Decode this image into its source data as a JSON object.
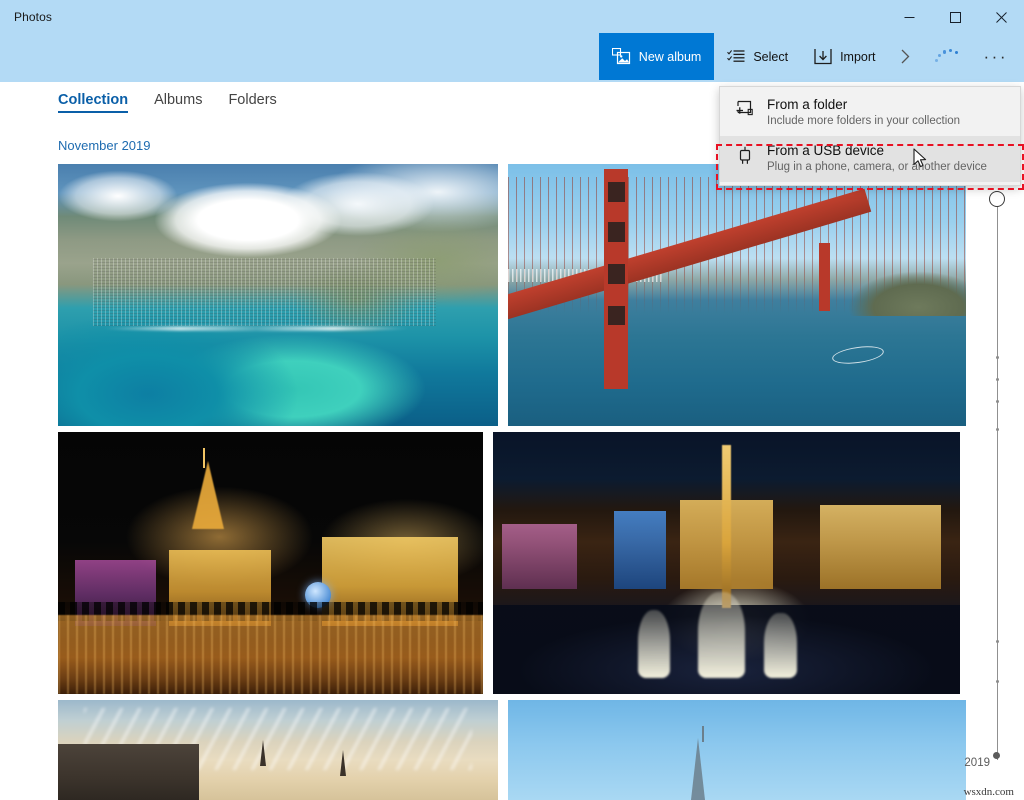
{
  "window": {
    "app_title": "Photos",
    "controls": {
      "minimize": "minimize-button",
      "maximize": "maximize-button",
      "close": "close-button"
    },
    "titlebar_color": "#b3daf5"
  },
  "toolbar": {
    "accent_color": "#0078d4",
    "new_album_label": "New album",
    "select_label": "Select",
    "import_label": "Import",
    "overflow_label": "···",
    "chevron_label": "›"
  },
  "nav": {
    "tabs": [
      {
        "label": "Collection",
        "active": true
      },
      {
        "label": "Albums",
        "active": false
      },
      {
        "label": "Folders",
        "active": false
      }
    ],
    "active_color": "#0a5fa8"
  },
  "content": {
    "date_header": "November 2019",
    "rows": [
      {
        "photos": [
          {
            "caption": "Aerial view of Honolulu coastline with clouds"
          },
          {
            "caption": "Golden Gate Bridge over the bay"
          }
        ]
      },
      {
        "photos": [
          {
            "caption": "Las Vegas strip at night with Paris hotel"
          },
          {
            "caption": "Bellagio fountains at night from above"
          }
        ]
      },
      {
        "photos": [
          {
            "caption": "Paris rooftops with streaked sky"
          },
          {
            "caption": "Eiffel Tower against blue sky"
          }
        ]
      }
    ]
  },
  "flyout": {
    "items": [
      {
        "icon": "folder-plus-icon",
        "title": "From a folder",
        "subtitle": "Include more folders in your collection",
        "hovered": false
      },
      {
        "icon": "usb-device-icon",
        "title": "From a USB device",
        "subtitle": "Plug in a phone, camera, or another device",
        "hovered": true
      }
    ],
    "highlight_color": "#e81123"
  },
  "timeline": {
    "year_label": "2019",
    "dot_positions": [
      168,
      190,
      212,
      240,
      452,
      492
    ]
  },
  "watermark": {
    "text": "wsxdn.com"
  }
}
